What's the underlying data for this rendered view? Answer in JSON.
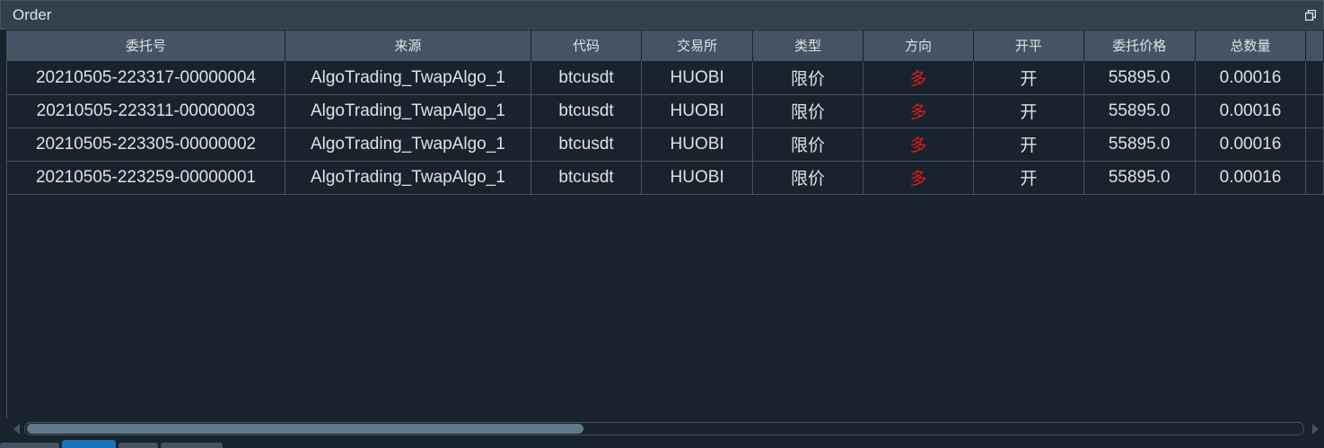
{
  "window": {
    "title": "Order"
  },
  "table": {
    "columns": [
      "委托号",
      "来源",
      "代码",
      "交易所",
      "类型",
      "方向",
      "开平",
      "委托价格",
      "总数量"
    ],
    "rows": [
      [
        "20210505-223317-00000004",
        "AlgoTrading_TwapAlgo_1",
        "btcusdt",
        "HUOBI",
        "限价",
        "多",
        "开",
        "55895.0",
        "0.00016"
      ],
      [
        "20210505-223311-00000003",
        "AlgoTrading_TwapAlgo_1",
        "btcusdt",
        "HUOBI",
        "限价",
        "多",
        "开",
        "55895.0",
        "0.00016"
      ],
      [
        "20210505-223305-00000002",
        "AlgoTrading_TwapAlgo_1",
        "btcusdt",
        "HUOBI",
        "限价",
        "多",
        "开",
        "55895.0",
        "0.00016"
      ],
      [
        "20210505-223259-00000001",
        "AlgoTrading_TwapAlgo_1",
        "btcusdt",
        "HUOBI",
        "限价",
        "多",
        "开",
        "55895.0",
        "0.00016"
      ]
    ],
    "direction_color": "#e01b1b"
  },
  "icons": {
    "float": "float-window-icon",
    "scroll_left": "arrow-left-icon",
    "scroll_right": "arrow-right-icon"
  },
  "colors": {
    "background": "#19232d",
    "header": "#455364",
    "text": "#e0e1e3",
    "accent": "#1a72bb"
  }
}
